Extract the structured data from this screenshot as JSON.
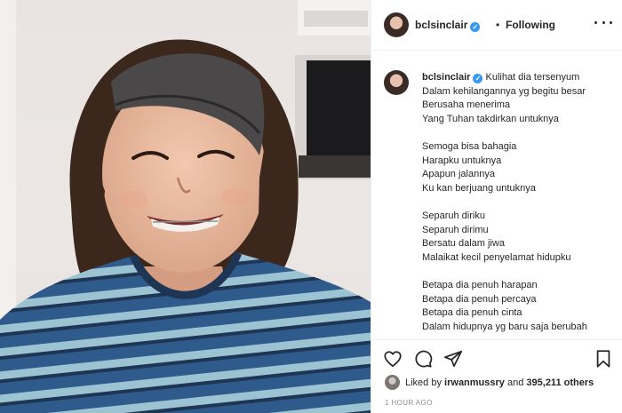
{
  "header": {
    "username": "bclsinclair",
    "verified_icon": "verified-badge-icon",
    "separator": "•",
    "follow_status": "Following",
    "more_icon": "more-options-icon"
  },
  "caption": {
    "username": "bclsinclair",
    "lines": [
      "Kulihat dia tersenyum",
      "Dalam kehilangannya yg begitu besar",
      "Berusaha menerima",
      "Yang Tuhan takdirkan untuknya",
      "Semoga bisa bahagia",
      "Harapku untuknya",
      "Apapun jalannya",
      "Ku kan berjuang untuknya",
      "Separuh diriku",
      "Separuh dirimu",
      "Bersatu dalam jiwa",
      "Malaikat kecil penyelamat hidupku",
      "Betapa dia penuh harapan",
      "Betapa dia penuh percaya",
      "Betapa dia penuh cinta",
      "Dalam hidupnya yg baru saja berubah"
    ]
  },
  "actions": {
    "like_icon": "heart-icon",
    "comment_icon": "comment-icon",
    "share_icon": "share-icon",
    "save_icon": "bookmark-icon"
  },
  "likes": {
    "prefix": "Liked by",
    "user": "irwanmussry",
    "middle": "and",
    "count": "395,211 others"
  },
  "timestamp": "1 HOUR AGO",
  "colors": {
    "text": "#262626",
    "muted": "#8e8e8e",
    "verified": "#3897f0",
    "border": "#efefef"
  }
}
